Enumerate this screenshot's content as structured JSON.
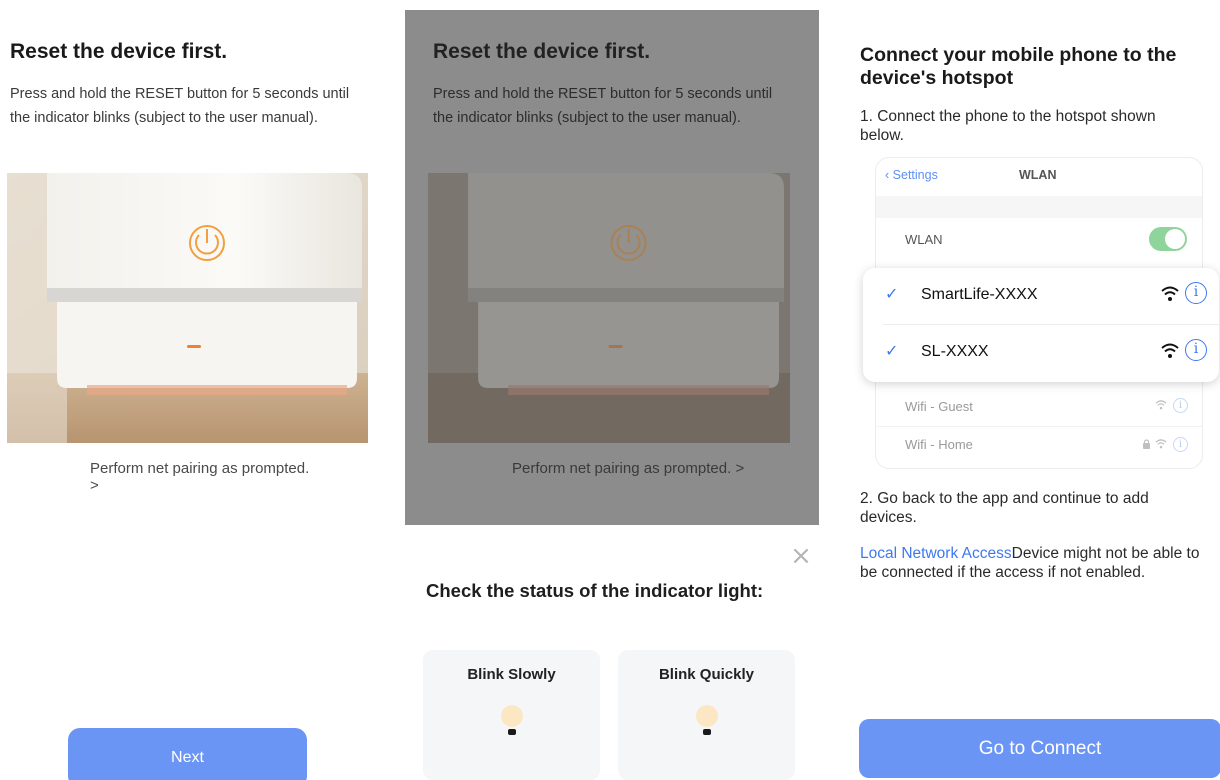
{
  "panel1": {
    "title": "Reset the device first.",
    "description": "Press and hold the RESET button for 5 seconds until the indicator blinks (subject to the user manual).",
    "pairing_link": "Perform net pairing as prompted. >",
    "next_label": "Next"
  },
  "panel2": {
    "title": "Reset the device first.",
    "description": "Press and hold the RESET button for 5 seconds until the indicator blinks (subject to the user manual).",
    "pairing_link": "Perform net pairing as prompted. >",
    "close_glyph": "×",
    "check_title": "Check the status of the indicator light:",
    "options": [
      {
        "label": "Blink Slowly"
      },
      {
        "label": "Blink Quickly"
      }
    ]
  },
  "panel3": {
    "title": "Connect your mobile phone to the device's hotspot",
    "step1": "1. Connect the phone to the hotspot shown below.",
    "settings_back": "Settings",
    "settings_title": "WLAN",
    "wlan_label": "WLAN",
    "networks": [
      {
        "name": "SmartLife-XXXX"
      },
      {
        "name": "SL-XXXX"
      }
    ],
    "other_networks": [
      {
        "name": "Wifi - Guest"
      },
      {
        "name": "Wifi - Home"
      }
    ],
    "step2": "2. Go back to the app and continue to add devices.",
    "access_link": "Local Network Access",
    "access_note": "Device might not be able to be connected if the access if not enabled.",
    "connect_label": "Go to Connect"
  },
  "icons": {
    "info": "i",
    "check": "✓",
    "back": "‹",
    "lock": "🔒"
  },
  "colors": {
    "accent_blue": "#6a95f5",
    "link_blue": "#3e78f0",
    "indicator_orange": "#f0a040",
    "toggle_green": "#8fd49a"
  }
}
